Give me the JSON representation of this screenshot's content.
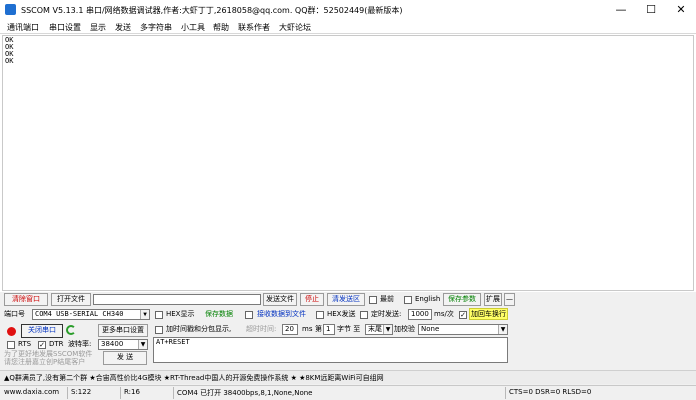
{
  "window": {
    "title": "SSCOM V5.13.1 串口/网络数据调试器,作者:大虾丁丁,2618058@qq.com. QQ群：52502449(最新版本)",
    "minimize": "—",
    "maximize": "☐",
    "close": "✕"
  },
  "menu": [
    "通讯端口",
    "串口设置",
    "显示",
    "发送",
    "多字符串",
    "小工具",
    "帮助",
    "联系作者",
    "大虾论坛"
  ],
  "receive_area": {
    "lines": [
      "OK",
      "OK",
      "OK",
      "OK"
    ]
  },
  "toolbar": {
    "clear_window": "清除窗口",
    "open_file": "打开文件",
    "file_path": "",
    "send_file": "发送文件",
    "stop": "停止",
    "clear_send": "清发送区",
    "topmost": "最前",
    "english": "English",
    "save_params": "保存参数",
    "expand": "扩展",
    "collapse": "—"
  },
  "port": {
    "label": "端口号",
    "value": "COM4 USB-SERIAL CH340",
    "close_port": "关闭串口",
    "more_settings": "更多串口设置",
    "rts": "RTS",
    "dtr": "DTR",
    "dtr_checked": true,
    "baud_label": "波特率:",
    "baud_value": "38400"
  },
  "options": {
    "hex_display": "HEX显示",
    "save_data": "保存数据",
    "recv_to_file": "接收数据到文件",
    "hex_send": "HEX发送",
    "timed_send": "定时发送:",
    "interval": "1000",
    "interval_unit": "ms/次",
    "add_crlf": "加回车换行",
    "add_crlf_checked": true,
    "add_timestamp": "加时间戳和分包显示,",
    "timeout_label": "超时时间:",
    "timeout_value": "20",
    "ms": "ms",
    "byte_prefix": "第",
    "byte_index": "1",
    "byte_suffix": "字节 至",
    "end_value": "末尾",
    "checksum_label": "加校验",
    "checksum_value": "None"
  },
  "send_area": {
    "text": "AT+RESET",
    "send_button": "发 送"
  },
  "promo": {
    "line1": "为了更好地发展SSCOM软件",
    "line2": "请您注册嘉立创P结尾客户"
  },
  "ticker": "▲Q群满员了,没有第二个群 ★合宙高性价比4G模块 ★RT-Thread中国人的开源免费操作系统 ★ ★8KM远距离WiFi可自组网",
  "status": {
    "site": "www.daxia.com",
    "sent": "S:122",
    "received": "R:16",
    "port_state": "COM4 已打开  38400bps,8,1,None,None",
    "lines": "CTS=0 DSR=0 RLSD=0"
  },
  "colors": {
    "red_text": "#cc0000",
    "green_text": "#008000",
    "blue_text": "#0030c0"
  }
}
